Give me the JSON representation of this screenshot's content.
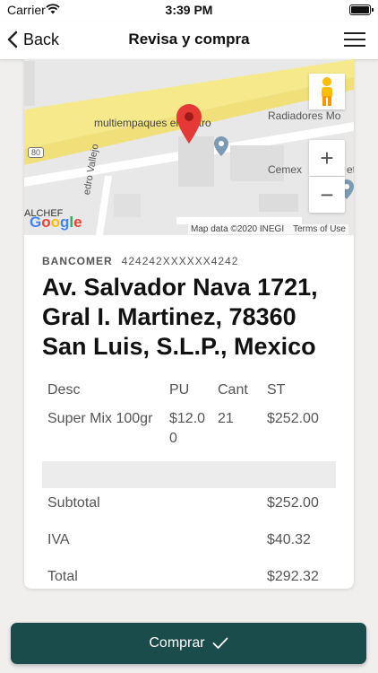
{
  "status": {
    "carrier": "Carrier",
    "time": "3:39 PM"
  },
  "nav": {
    "back": "Back",
    "title": "Revisa y compra"
  },
  "map": {
    "place": "multiempaques el centro",
    "place2": "Radiadores Mo",
    "place3": "Cemex",
    "place4": "et",
    "street": "edro Vallejo",
    "road_num": "80",
    "logo_text": "Google",
    "corner_label": "ALCHEF",
    "attribution": "Map data ©2020 INEGI",
    "terms": "Terms of Use",
    "zoom_in": "+",
    "zoom_out": "−"
  },
  "payment": {
    "bank": "BANCOMER",
    "card_number": "424242XXXXXX4242"
  },
  "address": {
    "line1": "Av. Salvador Nava 1721,",
    "line2": "Gral I. Martinez, 78360",
    "line3": "San Luis, S.L.P., Mexico"
  },
  "items": {
    "headers": [
      "Desc",
      "PU",
      "Cant",
      "ST"
    ],
    "rows": [
      {
        "desc": "Super Mix 100gr",
        "pu": "$12.00",
        "cant": "21",
        "st": "$252.00"
      }
    ]
  },
  "totals": {
    "subtotal_label": "Subtotal",
    "subtotal": "$252.00",
    "iva_label": "IVA",
    "iva": "$40.32",
    "total_label": "Total",
    "total": "$292.32"
  },
  "buy_button": {
    "label": "Comprar"
  },
  "colors": {
    "button": "#1b4c4c",
    "pin": "#e53935",
    "road": "#f5e98c"
  }
}
